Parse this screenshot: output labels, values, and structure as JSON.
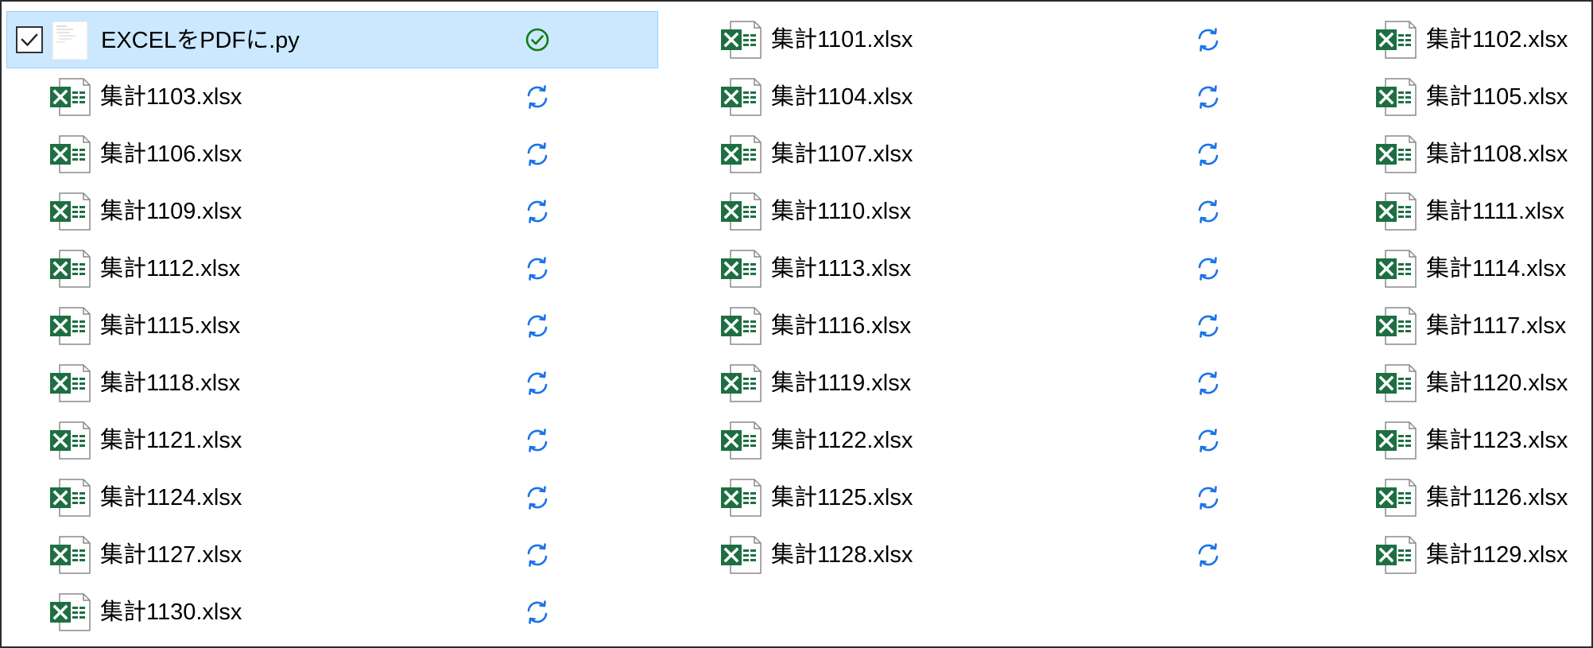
{
  "colors": {
    "excel_green": "#1d6f42",
    "sync_blue": "#1a73e8",
    "synced_green": "#107c10",
    "selection_bg": "#cce8ff",
    "selection_border": "#99d1ff"
  },
  "files": [
    {
      "name": "EXCELをPDFに.py",
      "type": "python",
      "icon": "python-file-icon",
      "status": "synced",
      "status_icon": "check-circle-icon",
      "selected": true
    },
    {
      "name": "集計1101.xlsx",
      "type": "excel",
      "icon": "excel-file-icon",
      "status": "syncing",
      "status_icon": "sync-icon"
    },
    {
      "name": "集計1102.xlsx",
      "type": "excel",
      "icon": "excel-file-icon",
      "status": "syncing",
      "status_icon": "sync-icon"
    },
    {
      "name": "集計1103.xlsx",
      "type": "excel",
      "icon": "excel-file-icon",
      "status": "syncing",
      "status_icon": "sync-icon"
    },
    {
      "name": "集計1104.xlsx",
      "type": "excel",
      "icon": "excel-file-icon",
      "status": "syncing",
      "status_icon": "sync-icon"
    },
    {
      "name": "集計1105.xlsx",
      "type": "excel",
      "icon": "excel-file-icon",
      "status": "syncing",
      "status_icon": "sync-icon"
    },
    {
      "name": "集計1106.xlsx",
      "type": "excel",
      "icon": "excel-file-icon",
      "status": "syncing",
      "status_icon": "sync-icon"
    },
    {
      "name": "集計1107.xlsx",
      "type": "excel",
      "icon": "excel-file-icon",
      "status": "syncing",
      "status_icon": "sync-icon"
    },
    {
      "name": "集計1108.xlsx",
      "type": "excel",
      "icon": "excel-file-icon",
      "status": "syncing",
      "status_icon": "sync-icon"
    },
    {
      "name": "集計1109.xlsx",
      "type": "excel",
      "icon": "excel-file-icon",
      "status": "syncing",
      "status_icon": "sync-icon"
    },
    {
      "name": "集計1110.xlsx",
      "type": "excel",
      "icon": "excel-file-icon",
      "status": "syncing",
      "status_icon": "sync-icon"
    },
    {
      "name": "集計1111.xlsx",
      "type": "excel",
      "icon": "excel-file-icon",
      "status": "syncing",
      "status_icon": "sync-icon"
    },
    {
      "name": "集計1112.xlsx",
      "type": "excel",
      "icon": "excel-file-icon",
      "status": "syncing",
      "status_icon": "sync-icon"
    },
    {
      "name": "集計1113.xlsx",
      "type": "excel",
      "icon": "excel-file-icon",
      "status": "syncing",
      "status_icon": "sync-icon"
    },
    {
      "name": "集計1114.xlsx",
      "type": "excel",
      "icon": "excel-file-icon",
      "status": "syncing",
      "status_icon": "sync-icon"
    },
    {
      "name": "集計1115.xlsx",
      "type": "excel",
      "icon": "excel-file-icon",
      "status": "syncing",
      "status_icon": "sync-icon"
    },
    {
      "name": "集計1116.xlsx",
      "type": "excel",
      "icon": "excel-file-icon",
      "status": "syncing",
      "status_icon": "sync-icon"
    },
    {
      "name": "集計1117.xlsx",
      "type": "excel",
      "icon": "excel-file-icon",
      "status": "syncing",
      "status_icon": "sync-icon"
    },
    {
      "name": "集計1118.xlsx",
      "type": "excel",
      "icon": "excel-file-icon",
      "status": "syncing",
      "status_icon": "sync-icon"
    },
    {
      "name": "集計1119.xlsx",
      "type": "excel",
      "icon": "excel-file-icon",
      "status": "syncing",
      "status_icon": "sync-icon"
    },
    {
      "name": "集計1120.xlsx",
      "type": "excel",
      "icon": "excel-file-icon",
      "status": "syncing",
      "status_icon": "sync-icon"
    },
    {
      "name": "集計1121.xlsx",
      "type": "excel",
      "icon": "excel-file-icon",
      "status": "syncing",
      "status_icon": "sync-icon"
    },
    {
      "name": "集計1122.xlsx",
      "type": "excel",
      "icon": "excel-file-icon",
      "status": "syncing",
      "status_icon": "sync-icon"
    },
    {
      "name": "集計1123.xlsx",
      "type": "excel",
      "icon": "excel-file-icon",
      "status": "syncing",
      "status_icon": "sync-icon"
    },
    {
      "name": "集計1124.xlsx",
      "type": "excel",
      "icon": "excel-file-icon",
      "status": "syncing",
      "status_icon": "sync-icon"
    },
    {
      "name": "集計1125.xlsx",
      "type": "excel",
      "icon": "excel-file-icon",
      "status": "syncing",
      "status_icon": "sync-icon"
    },
    {
      "name": "集計1126.xlsx",
      "type": "excel",
      "icon": "excel-file-icon",
      "status": "syncing",
      "status_icon": "sync-icon"
    },
    {
      "name": "集計1127.xlsx",
      "type": "excel",
      "icon": "excel-file-icon",
      "status": "syncing",
      "status_icon": "sync-icon"
    },
    {
      "name": "集計1128.xlsx",
      "type": "excel",
      "icon": "excel-file-icon",
      "status": "syncing",
      "status_icon": "sync-icon"
    },
    {
      "name": "集計1129.xlsx",
      "type": "excel",
      "icon": "excel-file-icon",
      "status": "syncing",
      "status_icon": "sync-icon"
    },
    {
      "name": "集計1130.xlsx",
      "type": "excel",
      "icon": "excel-file-icon",
      "status": "syncing",
      "status_icon": "sync-icon"
    }
  ]
}
